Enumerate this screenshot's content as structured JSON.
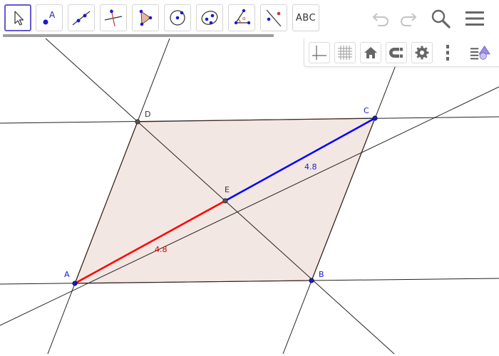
{
  "toolbar": {
    "tools": [
      {
        "name": "move-tool-icon"
      },
      {
        "name": "point-tool-icon",
        "label": "A"
      },
      {
        "name": "line-tool-icon"
      },
      {
        "name": "perpendicular-line-tool-icon"
      },
      {
        "name": "polygon-tool-icon"
      },
      {
        "name": "circle-tool-icon"
      },
      {
        "name": "ellipse-tool-icon"
      },
      {
        "name": "angle-tool-icon",
        "label": "α"
      },
      {
        "name": "reflect-tool-icon"
      },
      {
        "name": "text-tool",
        "label": "ABC"
      }
    ],
    "right_buttons": [
      "undo-icon",
      "redo-icon",
      "search-icon",
      "menu-icon"
    ]
  },
  "style_bar": {
    "buttons": [
      "axes-icon",
      "grid-icon",
      "home-icon",
      "point-capture-icon",
      "gear-icon",
      "more-vertical-icon",
      "stylebar-toggle-icon"
    ]
  },
  "construction": {
    "points": {
      "A": {
        "label": "A",
        "color": "#1a1acc"
      },
      "B": {
        "label": "B",
        "color": "#1a1acc"
      },
      "C": {
        "label": "C",
        "color": "#1a1acc"
      },
      "D": {
        "label": "D",
        "color": "#333333"
      },
      "E": {
        "label": "E",
        "color": "#333333"
      }
    },
    "segments": {
      "AE": {
        "label": "4.8",
        "color": "#ff0000"
      },
      "EC": {
        "label": "4.8",
        "color": "#0000ff"
      }
    },
    "polygon": {
      "fill": "#f3e7e3",
      "stroke": "#8b3a1a"
    }
  }
}
